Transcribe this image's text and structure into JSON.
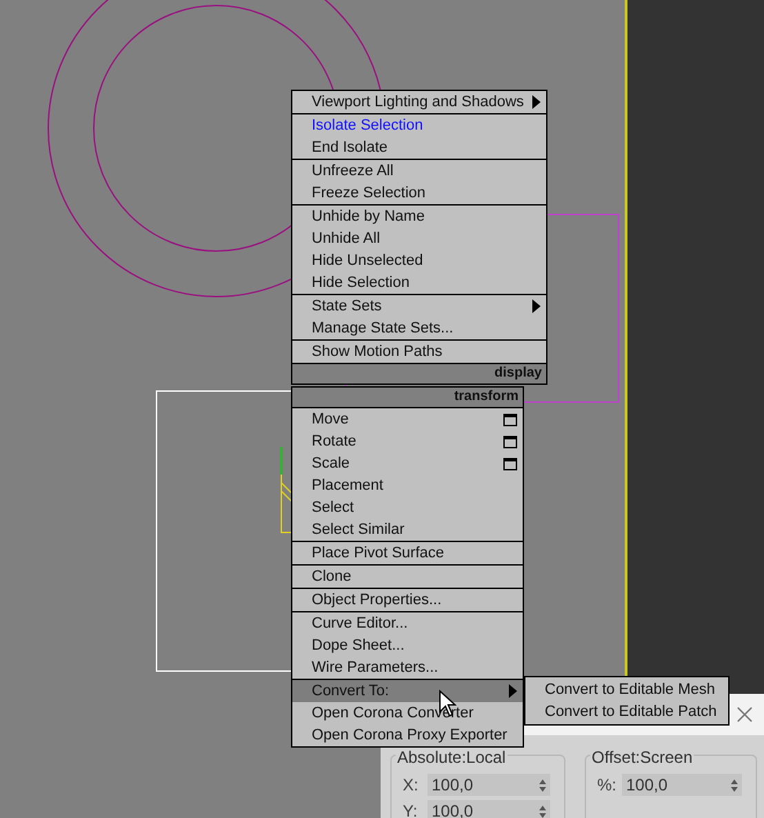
{
  "display_menu": {
    "title": "display",
    "groups": [
      [
        {
          "label": "Viewport Lighting and Shadows",
          "kind": "submenu",
          "active": false,
          "selected": false
        }
      ],
      [
        {
          "label": "Isolate Selection",
          "kind": "plain",
          "active": true,
          "selected": false
        },
        {
          "label": "End Isolate",
          "kind": "plain",
          "active": false,
          "selected": false
        }
      ],
      [
        {
          "label": "Unfreeze All",
          "kind": "plain",
          "active": false,
          "selected": false
        },
        {
          "label": "Freeze Selection",
          "kind": "plain",
          "active": false,
          "selected": false
        }
      ],
      [
        {
          "label": "Unhide by Name",
          "kind": "plain",
          "active": false,
          "selected": false
        },
        {
          "label": "Unhide All",
          "kind": "plain",
          "active": false,
          "selected": false
        },
        {
          "label": "Hide Unselected",
          "kind": "plain",
          "active": false,
          "selected": false
        },
        {
          "label": "Hide Selection",
          "kind": "plain",
          "active": false,
          "selected": false
        }
      ],
      [
        {
          "label": "State Sets",
          "kind": "submenu",
          "active": false,
          "selected": false
        },
        {
          "label": "Manage State Sets...",
          "kind": "plain",
          "active": false,
          "selected": false
        }
      ],
      [
        {
          "label": "Show Motion Paths",
          "kind": "plain",
          "active": false,
          "selected": false
        }
      ]
    ]
  },
  "transform_menu": {
    "title": "transform",
    "groups": [
      [
        {
          "label": "Move",
          "kind": "options",
          "active": false,
          "selected": false
        },
        {
          "label": "Rotate",
          "kind": "options",
          "active": false,
          "selected": false
        },
        {
          "label": "Scale",
          "kind": "options",
          "active": false,
          "selected": false
        },
        {
          "label": "Placement",
          "kind": "plain",
          "active": false,
          "selected": false
        },
        {
          "label": "Select",
          "kind": "plain",
          "active": false,
          "selected": false
        },
        {
          "label": "Select Similar",
          "kind": "plain",
          "active": false,
          "selected": false
        }
      ],
      [
        {
          "label": "Place Pivot Surface",
          "kind": "plain",
          "active": false,
          "selected": false
        }
      ],
      [
        {
          "label": "Clone",
          "kind": "plain",
          "active": false,
          "selected": false
        }
      ],
      [
        {
          "label": "Object Properties...",
          "kind": "plain",
          "active": false,
          "selected": false
        }
      ],
      [
        {
          "label": "Curve Editor...",
          "kind": "plain",
          "active": false,
          "selected": false
        },
        {
          "label": "Dope Sheet...",
          "kind": "plain",
          "active": false,
          "selected": false
        },
        {
          "label": "Wire Parameters...",
          "kind": "plain",
          "active": false,
          "selected": false
        }
      ],
      [
        {
          "label": "Convert To:",
          "kind": "submenu",
          "active": false,
          "selected": true
        },
        {
          "label": "Open Corona Converter",
          "kind": "plain",
          "active": false,
          "selected": false
        },
        {
          "label": "Open Corona Proxy Exporter",
          "kind": "plain",
          "active": false,
          "selected": false
        }
      ]
    ]
  },
  "submenu": {
    "items": [
      "Convert to Editable Mesh",
      "Convert to Editable Patch"
    ]
  },
  "dialog": {
    "groups": [
      {
        "title": "Absolute:Local",
        "fields": [
          {
            "label": "X:",
            "value": "100,0"
          },
          {
            "label": "Y:",
            "value": "100,0"
          }
        ]
      },
      {
        "title": "Offset:Screen",
        "fields": [
          {
            "label": "%:",
            "value": "100,0"
          }
        ]
      }
    ]
  }
}
